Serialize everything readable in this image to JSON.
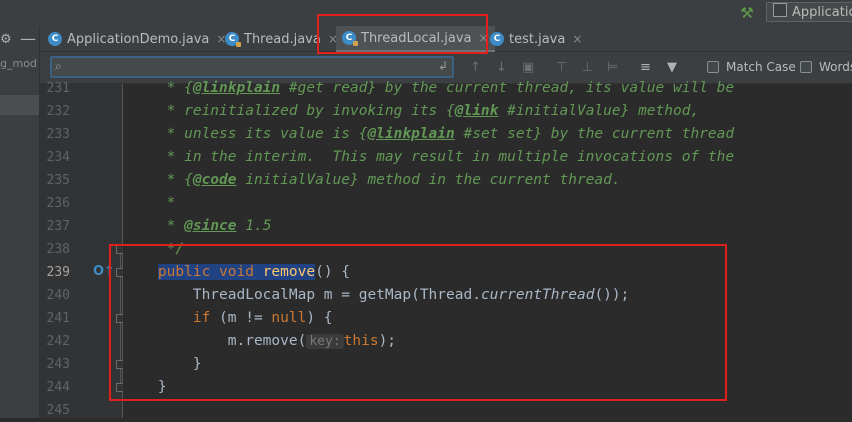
{
  "toolbar": {
    "run_config_label": "Applicatio"
  },
  "project_panel": {
    "item_label": "g_mod"
  },
  "tabs": [
    {
      "label": "ApplicationDemo.java",
      "close": "×"
    },
    {
      "label": "Thread.java",
      "close": "×"
    },
    {
      "label": "ThreadLocal.java",
      "close": "×"
    },
    {
      "label": "test.java",
      "close": "×"
    }
  ],
  "search": {
    "value": "",
    "match_case_label": "Match Case",
    "words_label": "Words",
    "match_case_checked": false,
    "words_checked": false
  },
  "editor": {
    "current_line": 239,
    "line_numbers": [
      "231",
      "232",
      "233",
      "234",
      "235",
      "236",
      "237",
      "238",
      "239",
      "240",
      "241",
      "242",
      "243",
      "244",
      "245"
    ],
    "lines": {
      "l231": {
        "a": " * {",
        "b": "@linkplain",
        "c": " #get read} by the current thread, its value will be"
      },
      "l232": {
        "a": " * reinitialized by invoking its {",
        "b": "@link",
        "c": " #initialValue} method,"
      },
      "l233": {
        "a": " * unless its value is {",
        "b": "@linkplain",
        "c": " #set set} by the current thread"
      },
      "l234": {
        "a": " * in the interim.  This may result in multiple invocations of the"
      },
      "l235": {
        "a": " * {",
        "b": "@code",
        "c": " initialValue} method in the current thread."
      },
      "l236": {
        "a": " *"
      },
      "l237": {
        "a": " * ",
        "b": "@since",
        "c": " 1.5"
      },
      "l238": {
        "a": " */"
      },
      "l239": {
        "kw1": "public",
        "kw2": "void",
        "fn": "remove",
        "rest": "() {"
      },
      "l240": {
        "a": "ThreadLocalMap m = getMap(Thread.",
        "it": "currentThread",
        "b": "());"
      },
      "l241": {
        "kw1": "if",
        "a": " (m != ",
        "kw2": "null",
        "b": ") {"
      },
      "l242": {
        "a": "m.remove(",
        "hint": "key:",
        "kw": "this",
        "b": ");"
      },
      "l243": {
        "a": "}"
      },
      "l244": {
        "a": "}"
      },
      "l245": {
        "a": ""
      }
    }
  },
  "colors": {
    "annotation_box": "#e0201b",
    "doc_comment": "#629755",
    "keyword": "#cc7832",
    "method": "#ffc66d",
    "selection": "#214283"
  }
}
